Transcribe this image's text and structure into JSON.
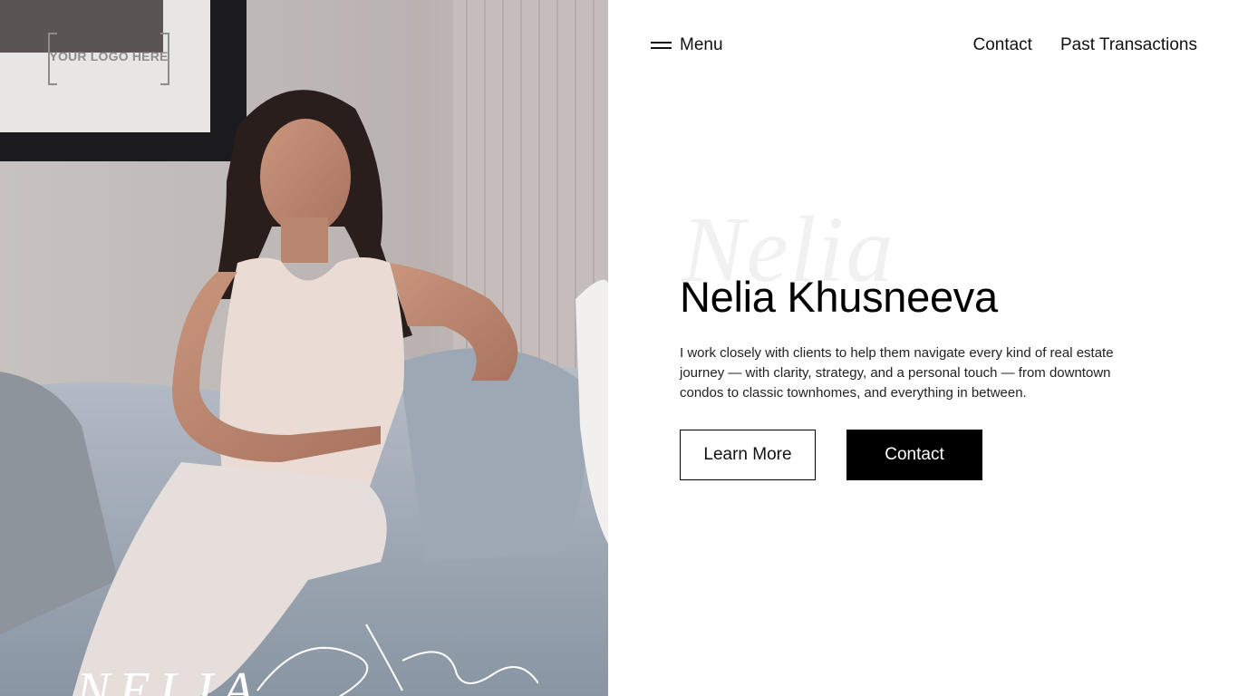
{
  "brand": {
    "logo_text": "YOUR LOGO HERE",
    "signature_caps": "NELIA",
    "signature_script": "Khusneeva"
  },
  "nav": {
    "menu_label": "Menu",
    "links": [
      "Contact",
      "Past Transactions"
    ]
  },
  "hero": {
    "ghost_script": "Nelia",
    "title": "Nelia Khusneeva",
    "description": "I work closely with clients to help them navigate every kind of real estate journey — with clarity, strategy, and a personal touch — from downtown condos to classic townhomes, and everything in between.",
    "buttons": {
      "learn_more": "Learn More",
      "contact": "Contact"
    }
  },
  "colors": {
    "background": "#ffffff",
    "text": "#111111",
    "primary_button": "#000000",
    "primary_button_text": "#ffffff"
  },
  "icons": [
    "hamburger-icon"
  ]
}
